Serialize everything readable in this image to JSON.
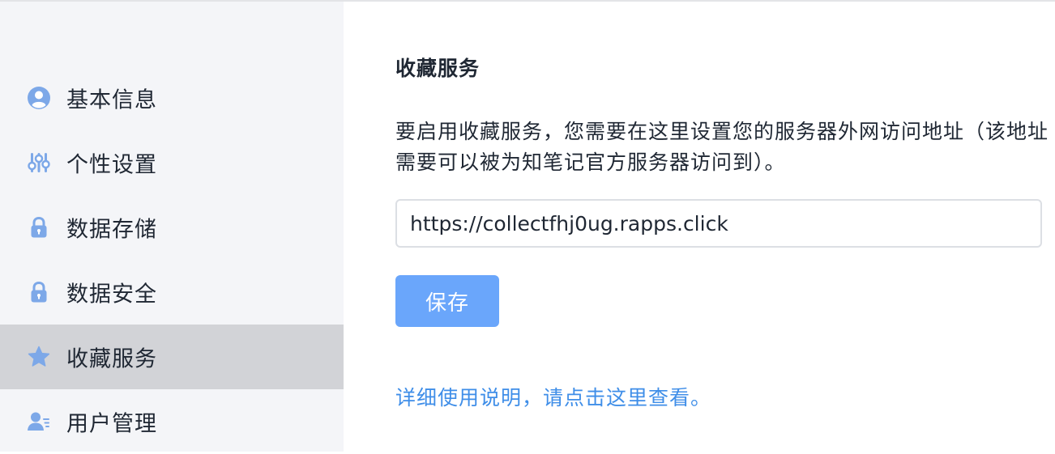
{
  "sidebar": {
    "items": [
      {
        "label": "基本信息",
        "icon": "user-circle-icon"
      },
      {
        "label": "个性设置",
        "icon": "sliders-icon"
      },
      {
        "label": "数据存储",
        "icon": "lock-icon"
      },
      {
        "label": "数据安全",
        "icon": "lock-icon"
      },
      {
        "label": "收藏服务",
        "icon": "star-icon",
        "active": true
      },
      {
        "label": "用户管理",
        "icon": "user-list-icon"
      }
    ]
  },
  "main": {
    "title": "收藏服务",
    "description": "要启用收藏服务，您需要在这里设置您的服务器外网访问地址（该地址需要可以被为知笔记官方服务器访问到）。",
    "url_value": "https://collectfhj0ug.rapps.click",
    "save_label": "保存",
    "help_link": "详细使用说明，请点击这里查看。"
  },
  "colors": {
    "accent": "#6aa6fb",
    "link": "#3f8ee8",
    "icon": "#7da8e8",
    "sidebar_bg": "#f4f5f8",
    "active_bg": "#d2d3d7"
  }
}
